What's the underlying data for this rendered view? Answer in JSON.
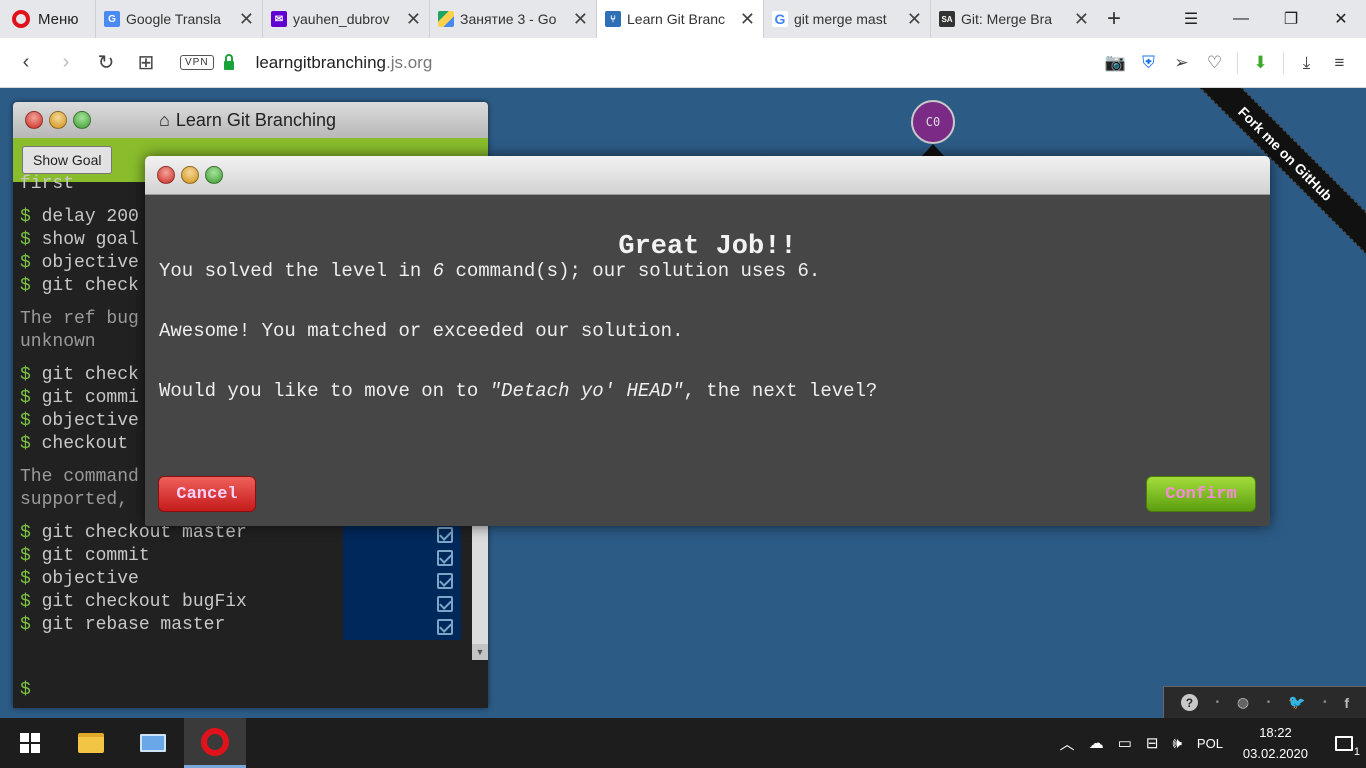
{
  "browser": {
    "menu_label": "Меню",
    "tabs": [
      {
        "title": "Google Transla",
        "fade": "te",
        "favicon": "google-translate-icon",
        "active": false
      },
      {
        "title": "yauhen_dubrov",
        "fade": "",
        "favicon": "yahoo-mail-icon",
        "active": false
      },
      {
        "title": "Занятие 3 - Go",
        "fade": "",
        "favicon": "google-drive-icon",
        "active": false
      },
      {
        "title": "Learn Git Branc",
        "fade": "",
        "favicon": "git-branching-icon",
        "active": true
      },
      {
        "title": "git merge mast",
        "fade": "",
        "favicon": "google-icon",
        "active": false
      },
      {
        "title": "Git: Merge Bra",
        "fade": "",
        "favicon": "sa-icon",
        "active": false
      }
    ],
    "vpn_label": "VPN",
    "url_host": "learngitbranching",
    "url_rest": ".js.org"
  },
  "terminal": {
    "title": "Learn Git Branching",
    "show_goal": "Show Goal",
    "lines": [
      {
        "text": "first",
        "type": "cmd",
        "prompt": false
      },
      {
        "text": " delay 200",
        "type": "cmd",
        "prompt": true
      },
      {
        "text": " show goal",
        "type": "cmd",
        "prompt": true
      },
      {
        "text": " objective",
        "type": "cmd",
        "prompt": true
      },
      {
        "text": " git check",
        "type": "cmd",
        "prompt": true
      },
      {
        "text": "The ref bug",
        "type": "note",
        "prompt": false
      },
      {
        "text": "unknown",
        "type": "note",
        "prompt": false
      },
      {
        "text": " git check",
        "type": "cmd",
        "prompt": true
      },
      {
        "text": " git commi",
        "type": "cmd",
        "prompt": true
      },
      {
        "text": " objective",
        "type": "cmd",
        "prompt": true
      },
      {
        "text": " checkout",
        "type": "cmd",
        "prompt": true
      },
      {
        "text": "The command",
        "type": "note",
        "prompt": false
      },
      {
        "text": "supported,",
        "type": "note",
        "prompt": false
      },
      {
        "text": " git checkout master",
        "type": "cmd",
        "prompt": true
      },
      {
        "text": " git commit",
        "type": "cmd",
        "prompt": true
      },
      {
        "text": " objective",
        "type": "cmd",
        "prompt": true
      },
      {
        "text": " git checkout bugFix",
        "type": "cmd",
        "prompt": true
      },
      {
        "text": " git rebase master",
        "type": "cmd",
        "prompt": true
      }
    ],
    "prompt_symbol": "$"
  },
  "graph": {
    "commit_label": "C0"
  },
  "ribbon": "Fork me on GitHub",
  "modal": {
    "heading": "Great Job!!",
    "line1_a": "You solved the level in ",
    "line1_num": "6",
    "line1_b": " command(s); our solution uses 6.",
    "line2": "Awesome! You matched or exceeded our solution.",
    "line3_a": "Would you like to move on to ",
    "line3_level": "\"Detach yo' HEAD\"",
    "line3_b": ", the next level?",
    "cancel": "Cancel",
    "confirm": "Confirm"
  },
  "taskbar": {
    "lang": "POL",
    "time": "18:22",
    "date": "03.02.2020",
    "notifications": "1"
  }
}
